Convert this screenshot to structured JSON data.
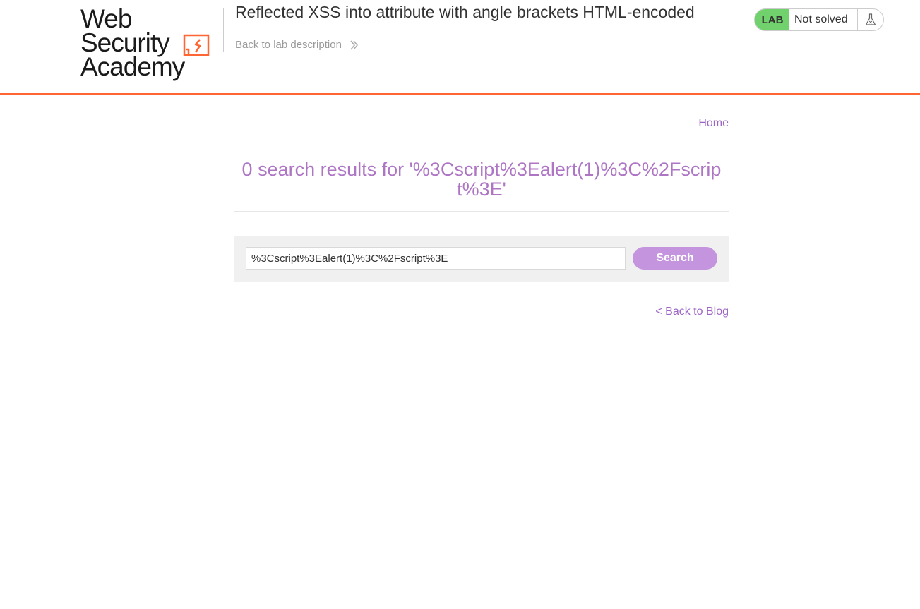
{
  "header": {
    "logo_line1": "Web Security",
    "logo_line2": "Academy",
    "lab_title": "Reflected XSS into attribute with angle brackets HTML-encoded",
    "back_link": "Back to lab description",
    "status": {
      "badge": "LAB",
      "text": "Not solved",
      "icon": "flask-icon"
    }
  },
  "nav": {
    "home": "Home"
  },
  "main": {
    "results_heading": "0 search results for '%3Cscript%3Ealert(1)%3C%2Fscript%3E'",
    "search": {
      "value": "%3Cscript%3Ealert(1)%3C%2Fscript%3E",
      "button": "Search"
    },
    "back_to_blog": "< Back to Blog"
  },
  "colors": {
    "accent_orange": "#ff6633",
    "link_purple": "#9d64c4",
    "heading_purple": "#ae75c5",
    "button_purple": "#c495de",
    "lab_green": "#70d16d"
  }
}
